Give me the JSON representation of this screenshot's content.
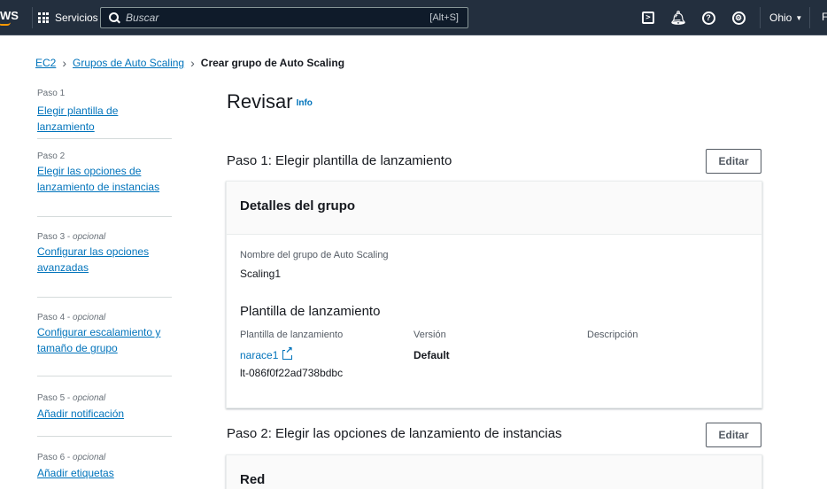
{
  "nav": {
    "logo": "WS",
    "services_label": "Servicios",
    "search_placeholder": "Buscar",
    "search_shortcut": "[Alt+S]",
    "region_label": "Ohio",
    "account_initial": "F"
  },
  "breadcrumb": {
    "items": [
      "EC2",
      "Grupos de Auto Scaling"
    ],
    "current": "Crear grupo de Auto Scaling"
  },
  "steps": [
    {
      "num": "Paso 1",
      "optional": "",
      "label": "Elegir plantilla de lanzamiento"
    },
    {
      "num": "Paso 2",
      "optional": "",
      "label": "Elegir las opciones de lanzamiento de instancias"
    },
    {
      "num": "Paso 3",
      "optional": "opcional",
      "label": "Configurar las opciones avanzadas"
    },
    {
      "num": "Paso 4",
      "optional": "opcional",
      "label": "Configurar escalamiento y tamaño de grupo"
    },
    {
      "num": "Paso 5",
      "optional": "opcional",
      "label": "Añadir notificación"
    },
    {
      "num": "Paso 6",
      "optional": "opcional",
      "label": "Añadir etiquetas"
    }
  ],
  "main": {
    "title": "Revisar",
    "info_label": "Info",
    "section1": {
      "title": "Paso 1: Elegir plantilla de lanzamiento",
      "edit_label": "Editar",
      "card_title": "Detalles del grupo",
      "group_name_label": "Nombre del grupo de Auto Scaling",
      "group_name_value": "Scaling1",
      "template_heading": "Plantilla de lanzamiento",
      "col_template_label": "Plantilla de lanzamiento",
      "col_version_label": "Versión",
      "col_description_label": "Descripción",
      "template_name": "narace1",
      "template_id": "lt-086f0f22ad738bdbc",
      "version_value": "Default"
    },
    "section2": {
      "title": "Paso 2: Elegir las opciones de lanzamiento de instancias",
      "edit_label": "Editar",
      "card_title": "Red"
    }
  }
}
